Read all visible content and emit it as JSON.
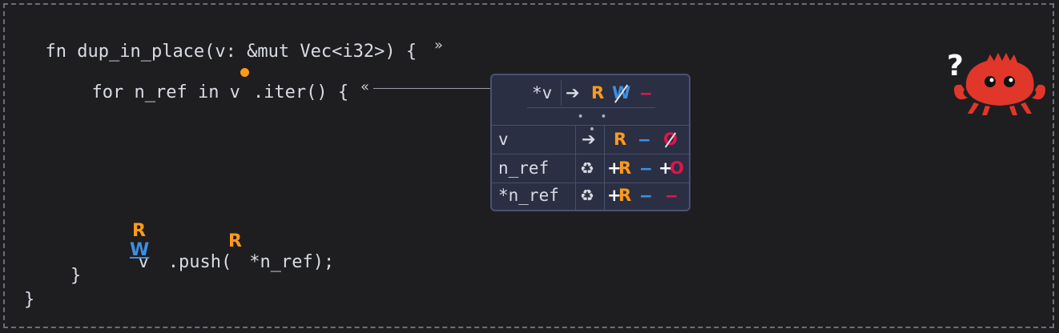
{
  "code": {
    "line1": "fn dup_in_place(v: &mut Vec<i32>) {",
    "line2_before": "for n_ref in v",
    "line2_after": ".iter() {",
    "line3_before": "v",
    "line3_mid": ".push(",
    "line3_after": "*n_ref);",
    "line4": "}",
    "line5": "}",
    "marker_after": "»",
    "marker_before": "«"
  },
  "inline_perms": {
    "push_receiver_top": "R",
    "push_receiver_bottom": "W",
    "push_arg": "R"
  },
  "permissions_table": {
    "header": {
      "path": "*v",
      "arrow": "➔",
      "r": "R",
      "w": "W",
      "o": "–"
    },
    "ellipsis": "• • •",
    "rows": [
      {
        "path": "v",
        "icon": "➔",
        "r": "R",
        "w": "–",
        "o": "O"
      },
      {
        "path": "n_ref",
        "icon": "♻",
        "r_prefix": "+",
        "r": "R",
        "w": "–",
        "o_prefix": "+",
        "o": "O"
      },
      {
        "path": "*n_ref",
        "icon": "♻",
        "r_prefix": "+",
        "r": "R",
        "w": "–",
        "o": "–"
      }
    ]
  },
  "mascot": {
    "question": "?"
  },
  "colors": {
    "read": "#ff9a1a",
    "write": "#3d8fe0",
    "own": "#e0144c",
    "background": "#1e1e21"
  }
}
